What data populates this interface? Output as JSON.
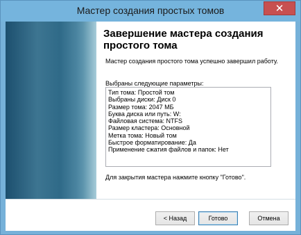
{
  "window": {
    "title": "Мастер создания простых томов",
    "close_glyph": "✕"
  },
  "page": {
    "title": "Завершение мастера создания простого тома",
    "description": "Мастер создания простого тома успешно завершил работу.",
    "params_label": "Выбраны следующие параметры:",
    "params": [
      "Тип тома: Простой том",
      "Выбраны диски: Диск 0",
      "Размер тома: 2047 МБ",
      "Буква диска или путь: W:",
      "Файловая система: NTFS",
      "Размер кластера: Основной",
      "Метка тома: Новый том",
      "Быстрое форматирование: Да",
      "Применение сжатия файлов и папок: Нет"
    ],
    "footer": "Для закрытия мастера нажмите кнопку \"Готово\"."
  },
  "buttons": {
    "back": "< Назад",
    "finish": "Готово",
    "cancel": "Отмена"
  },
  "colors": {
    "title_bar": "#75b4dd",
    "close_button": "#c75050",
    "side_panel": "#2f6a88"
  }
}
